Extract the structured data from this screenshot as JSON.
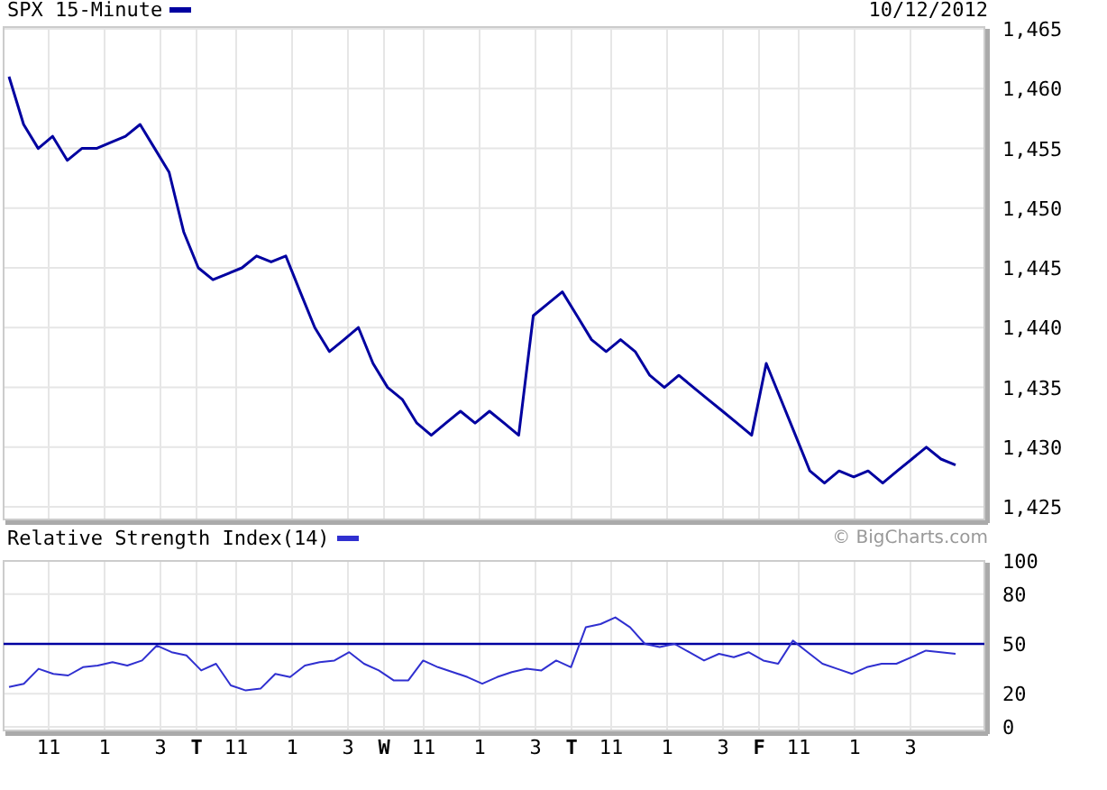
{
  "price_chart": {
    "title": "SPX 15-Minute",
    "date": "10/12/2012",
    "chart_data": {
      "type": "line",
      "grid": true,
      "ylim": [
        1425,
        1465
      ],
      "yticks": [
        {
          "value": 1465,
          "label": "1,465"
        },
        {
          "value": 1460,
          "label": "1,460"
        },
        {
          "value": 1455,
          "label": "1,455"
        },
        {
          "value": 1450,
          "label": "1,450"
        },
        {
          "value": 1445,
          "label": "1,445"
        },
        {
          "value": 1440,
          "label": "1,440"
        },
        {
          "value": 1435,
          "label": "1,435"
        },
        {
          "value": 1430,
          "label": "1,430"
        },
        {
          "value": 1425,
          "label": "1,425"
        }
      ],
      "series": [
        {
          "color": "#0000a0",
          "values": [
            1461,
            1457,
            1455,
            1456,
            1454,
            1455,
            1455,
            1455.5,
            1456,
            1457,
            1455,
            1453,
            1448,
            1445,
            1444,
            1444.5,
            1445,
            1446,
            1445.5,
            1446,
            1443,
            1440,
            1438,
            1439,
            1440,
            1437,
            1435,
            1434,
            1432,
            1431,
            1432,
            1433,
            1432,
            1433,
            1432,
            1431,
            1441,
            1442,
            1443,
            1441,
            1439,
            1438,
            1439,
            1438,
            1436,
            1435,
            1436,
            1435,
            1434,
            1433,
            1432,
            1431,
            1437,
            1434,
            1431,
            1428,
            1427,
            1428,
            1427.5,
            1428,
            1427,
            1428,
            1429,
            1430,
            1429,
            1428.5
          ]
        }
      ]
    }
  },
  "rsi_chart": {
    "title": "Relative Strength Index(14)",
    "credit": "© BigCharts.com",
    "chart_data": {
      "type": "line",
      "grid": true,
      "ylim": [
        0,
        100
      ],
      "yticks": [
        0,
        20,
        50,
        80,
        100
      ],
      "ref_lines": [
        {
          "axis": "y",
          "value": 50,
          "color": "#0000a0"
        }
      ],
      "series": [
        {
          "color": "#3030d0",
          "values": [
            24,
            26,
            35,
            32,
            31,
            36,
            37,
            39,
            37,
            40,
            49,
            45,
            43,
            34,
            38,
            25,
            22,
            23,
            32,
            30,
            37,
            39,
            40,
            45,
            38,
            34,
            28,
            28,
            40,
            36,
            33,
            30,
            26,
            30,
            33,
            35,
            34,
            40,
            36,
            60,
            62,
            66,
            60,
            50,
            48,
            50,
            45,
            40,
            44,
            42,
            45,
            40,
            38,
            52,
            45,
            38,
            35,
            32,
            36,
            38,
            38,
            42,
            46,
            45,
            44
          ]
        }
      ]
    }
  },
  "x_axis_labels": [
    {
      "label": "11",
      "day": false
    },
    {
      "label": "1",
      "day": false
    },
    {
      "label": "3",
      "day": false
    },
    {
      "label": "T",
      "day": true
    },
    {
      "label": "11",
      "day": false
    },
    {
      "label": "1",
      "day": false
    },
    {
      "label": "3",
      "day": false
    },
    {
      "label": "W",
      "day": true
    },
    {
      "label": "11",
      "day": false
    },
    {
      "label": "1",
      "day": false
    },
    {
      "label": "3",
      "day": false
    },
    {
      "label": "T",
      "day": true
    },
    {
      "label": "11",
      "day": false
    },
    {
      "label": "1",
      "day": false
    },
    {
      "label": "3",
      "day": false
    },
    {
      "label": "F",
      "day": true
    },
    {
      "label": "11",
      "day": false
    },
    {
      "label": "1",
      "day": false
    },
    {
      "label": "3",
      "day": false
    }
  ]
}
